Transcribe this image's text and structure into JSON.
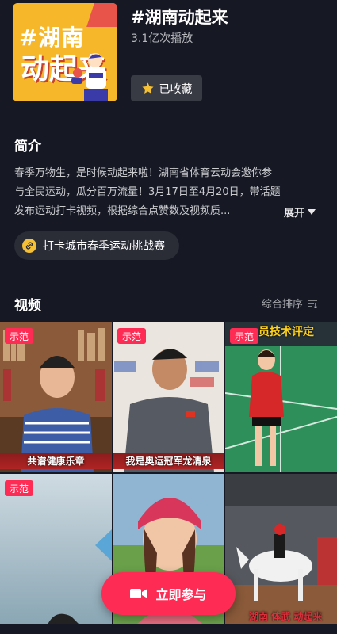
{
  "topic": {
    "cover_hash": "#湖南",
    "cover_big": "动起来",
    "title": "#湖南动起来",
    "plays": "3.1亿次播放",
    "favorite_label": "已收藏"
  },
  "intro": {
    "heading": "简介",
    "lines": [
      "春季万物生，是时候动起来啦！湖南省体育云动会邀你参",
      "与全民运动，瓜分百万流量！3月17日至4月20日，带话题",
      "发布运动打卡视频，根据综合点赞数及视频质..."
    ],
    "expand_label": "展开"
  },
  "tag": {
    "label": "打卡城市春季运动挑战赛"
  },
  "videos": {
    "heading": "视频",
    "sort_label": "综合排序",
    "badge": "示范",
    "items": [
      {
        "caption": "共谱健康乐章"
      },
      {
        "caption": "我是奥运冠军龙清泉"
      },
      {
        "overlay_text": "员技术评定"
      },
      {
        "caption": ""
      },
      {
        "caption": ""
      },
      {
        "bottom_text": "湖南 体武 动起来"
      }
    ]
  },
  "cta": {
    "label": "立即参与"
  },
  "colors": {
    "accent": "#fe2c55",
    "background": "#161823",
    "gold": "#f5c033"
  }
}
